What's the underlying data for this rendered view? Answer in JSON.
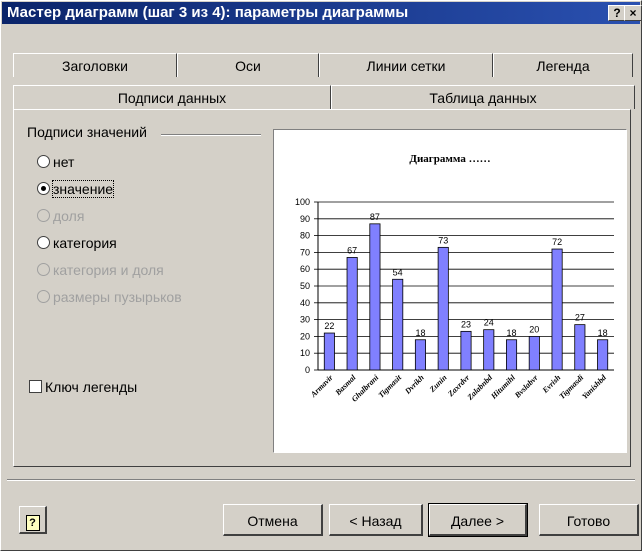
{
  "window": {
    "title": "Мастер диаграмм (шаг 3 из 4): параметры диаграммы",
    "help_btn": "?",
    "close_btn": "×"
  },
  "tabs_top": [
    "Заголовки",
    "Оси",
    "Линии сетки",
    "Легенда"
  ],
  "tabs_bottom": [
    "Подписи данных",
    "Таблица данных"
  ],
  "labels_group": {
    "title": "Подписи значений",
    "options": [
      {
        "label": "нет",
        "selected": false,
        "enabled": true
      },
      {
        "label": "значение",
        "selected": true,
        "enabled": true
      },
      {
        "label": "доля",
        "selected": false,
        "enabled": false
      },
      {
        "label": "категория",
        "selected": false,
        "enabled": true
      },
      {
        "label": "категория и доля",
        "selected": false,
        "enabled": false
      },
      {
        "label": "размеры пузырьков",
        "selected": false,
        "enabled": false
      }
    ]
  },
  "legend_key": {
    "label": "Ключ легенды",
    "checked": false
  },
  "buttons": {
    "help": "?",
    "cancel": "Отмена",
    "back": "< Назад",
    "next": "Далее >",
    "finish": "Готово"
  },
  "colors": {
    "bar": "#8080ff",
    "title_bar": "#0a246a"
  },
  "chart_data": {
    "type": "bar",
    "title": "Диаграмма ……",
    "categories": [
      "Armavir",
      "Basmal",
      "Ghalbrani",
      "Tigmasit",
      "Dvrikh",
      "Zunin",
      "Zaxrdvr",
      "Zalabnbd",
      "Hitumihl",
      "Bvslabvr",
      "Evrish",
      "Tigmasdi",
      "Yanishbd"
    ],
    "values": [
      22,
      67,
      87,
      54,
      18,
      73,
      23,
      24,
      18,
      20,
      72,
      27,
      18
    ],
    "ylim": [
      0,
      100
    ],
    "yticks": [
      0,
      10,
      20,
      30,
      40,
      50,
      60,
      70,
      80,
      90,
      100
    ],
    "grid": true
  }
}
